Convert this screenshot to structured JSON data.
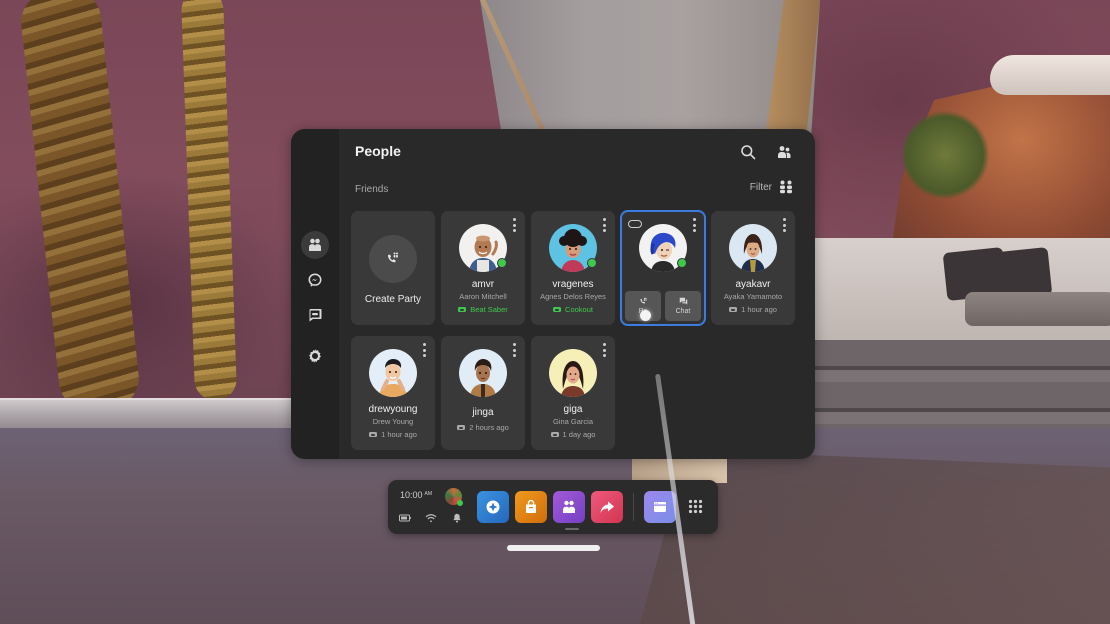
{
  "panel": {
    "title": "People",
    "section_label": "Friends",
    "filter_label": "Filter",
    "accent_color": "#3c7ce0",
    "online_color": "#3ec94e",
    "nav": [
      {
        "name": "people",
        "icon": "people-icon",
        "active": true
      },
      {
        "name": "messenger",
        "icon": "messenger-icon",
        "active": false
      },
      {
        "name": "chats",
        "icon": "chat-bubble-icon",
        "active": false
      },
      {
        "name": "settings",
        "icon": "gear-icon",
        "active": false
      }
    ]
  },
  "create_party": {
    "label": "Create Party",
    "icon": "party-call-icon"
  },
  "friends": [
    {
      "username": "amvr",
      "real_name": "Aaron Mitchell",
      "status": "Beat Saber",
      "status_type": "playing",
      "online": true
    },
    {
      "username": "vragenes",
      "real_name": "Agnes Delos Reyes",
      "status": "Cookout",
      "status_type": "playing",
      "online": true
    },
    {
      "username": "",
      "real_name": "",
      "status": "",
      "status_type": "hover",
      "online": true,
      "highlighted": true,
      "quick_actions": [
        "Party",
        "Chat"
      ],
      "quick_action_party_visible": "Pa"
    },
    {
      "username": "ayakavr",
      "real_name": "Ayaka Yamamoto",
      "status": "1 hour ago",
      "status_type": "last-seen",
      "online": false
    },
    {
      "username": "drewyoung",
      "real_name": "Drew Young",
      "status": "1 hour ago",
      "status_type": "last-seen",
      "online": false
    },
    {
      "username": "jinga",
      "real_name": "",
      "status": "2 hours ago",
      "status_type": "last-seen",
      "online": false
    },
    {
      "username": "giga",
      "real_name": "Gina Garcia",
      "status": "1 day ago",
      "status_type": "last-seen",
      "online": false
    }
  ],
  "dock": {
    "time": "10:00",
    "ampm": "AM",
    "system_icons": [
      "battery-icon",
      "wifi-icon",
      "bell-icon"
    ],
    "apps": [
      {
        "name": "explore",
        "icon": "compass-icon",
        "color": "#2e7fd0"
      },
      {
        "name": "store",
        "icon": "shopping-bag-icon",
        "color": "#e08a12"
      },
      {
        "name": "people",
        "icon": "people-icon",
        "color": "#8e4fd0"
      },
      {
        "name": "share",
        "icon": "share-arrow-icon",
        "color": "#e0466a"
      },
      {
        "name": "browser",
        "icon": "browser-window-icon",
        "color": "#8a7ae6"
      }
    ],
    "app_library_icon": "grid-icon"
  }
}
